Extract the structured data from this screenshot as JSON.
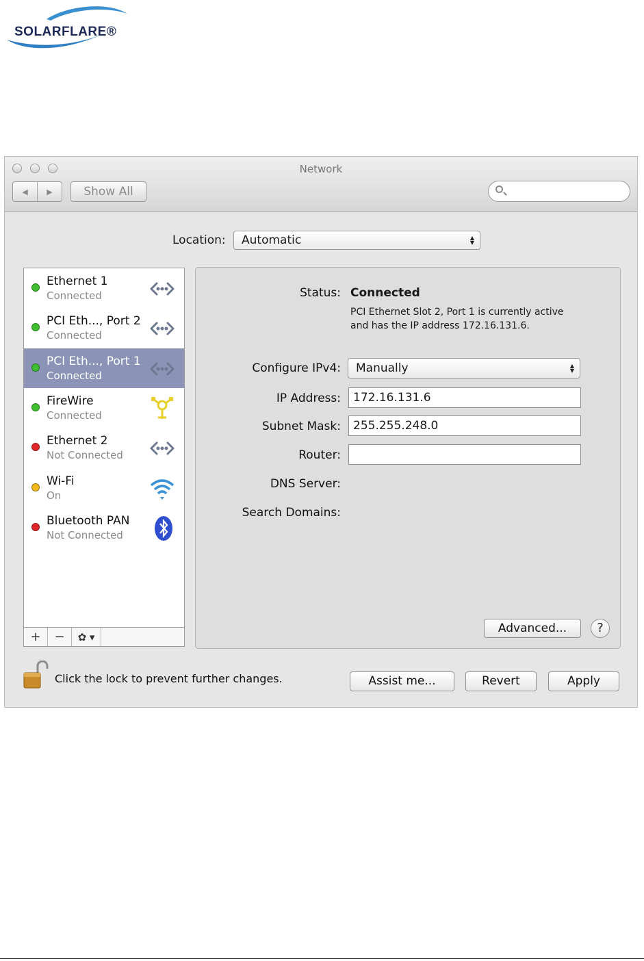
{
  "brand": {
    "logo_text": "SOLARFLARE®"
  },
  "window": {
    "title": "Network",
    "show_all": "Show All",
    "search": {
      "placeholder": "",
      "value": ""
    }
  },
  "location": {
    "label": "Location:",
    "value": "Automatic"
  },
  "services": [
    {
      "name": "Ethernet 1",
      "status": "Connected",
      "dot": "#3fbf2f",
      "icon": "ethernet-icon",
      "selected": false
    },
    {
      "name": "PCI Eth..., Port 2",
      "status": "Connected",
      "dot": "#3fbf2f",
      "icon": "ethernet-icon",
      "selected": false
    },
    {
      "name": "PCI Eth..., Port 1",
      "status": "Connected",
      "dot": "#3fbf2f",
      "icon": "ethernet-icon",
      "selected": true
    },
    {
      "name": "FireWire",
      "status": "Connected",
      "dot": "#3fbf2f",
      "icon": "firewire-icon",
      "selected": false
    },
    {
      "name": "Ethernet 2",
      "status": "Not Connected",
      "dot": "#e0262a",
      "icon": "ethernet-icon",
      "selected": false
    },
    {
      "name": "Wi-Fi",
      "status": "On",
      "dot": "#f1b81c",
      "icon": "wifi-icon",
      "selected": false
    },
    {
      "name": "Bluetooth PAN",
      "status": "Not Connected",
      "dot": "#e0262a",
      "icon": "bluetooth-icon",
      "selected": false
    }
  ],
  "list_toolbar": {
    "add": "+",
    "remove": "−",
    "gear": "✿ ▾"
  },
  "detail": {
    "status_label": "Status:",
    "status_value": "Connected",
    "status_desc_1": "PCI Ethernet Slot 2, Port 1 is currently active",
    "status_desc_2": "and has the IP address 172.16.131.6.",
    "configure_label": "Configure IPv4:",
    "configure_value": "Manually",
    "ip_label": "IP Address:",
    "ip_value": "172.16.131.6",
    "subnet_label": "Subnet Mask:",
    "subnet_value": "255.255.248.0",
    "router_label": "Router:",
    "router_value": "",
    "dns_label": "DNS Server:",
    "search_domains_label": "Search Domains:",
    "advanced": "Advanced...",
    "help": "?"
  },
  "footer": {
    "lock_text": "Click the lock to prevent further changes.",
    "assist": "Assist me...",
    "revert": "Revert",
    "apply": "Apply"
  }
}
